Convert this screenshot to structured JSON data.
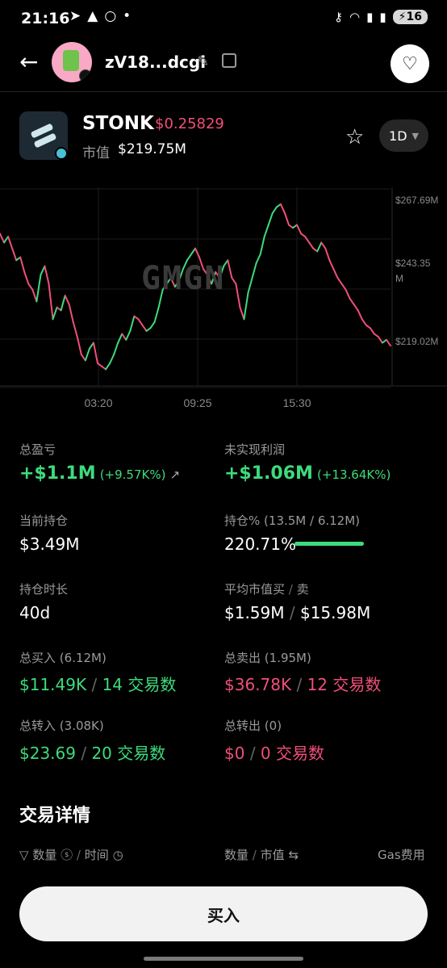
{
  "status_bar": {
    "time": "21:16",
    "battery": "16"
  },
  "header": {
    "wallet_name": "zV18...dcgi"
  },
  "token": {
    "symbol": "STONK",
    "price": "$0.25829",
    "mcap_label": "市值",
    "mcap_value": "$219.75M",
    "interval": "1D"
  },
  "chart_data": {
    "type": "line",
    "watermark": "GMGN",
    "y_ticks": [
      "$267.69M",
      "$243.35",
      "M",
      "$219.02M"
    ],
    "x_ticks": [
      "03:20",
      "09:25",
      "15:30"
    ],
    "ylim": [
      205,
      268
    ],
    "unit": "M",
    "colors": {
      "up": "#3ddb7b",
      "down": "#f04f78"
    },
    "series": [
      {
        "values": [
          255,
          252,
          254,
          250,
          246,
          247,
          242,
          238,
          236,
          232,
          241,
          244,
          238,
          226,
          230,
          229,
          234,
          231,
          225,
          220,
          214,
          212,
          216,
          218,
          211,
          210,
          209,
          211,
          214,
          218,
          221,
          219,
          222,
          227,
          226,
          224,
          222,
          223,
          225,
          230,
          236,
          238,
          240,
          237,
          239,
          243,
          246,
          248,
          250,
          247,
          243,
          241,
          238,
          242,
          240,
          244,
          246,
          240,
          238,
          230,
          226,
          235,
          240,
          245,
          248,
          254,
          258,
          262,
          264,
          265,
          262,
          258,
          257,
          258,
          255,
          254,
          252,
          250,
          249,
          252,
          250,
          246,
          243,
          240,
          238,
          236,
          233,
          231,
          229,
          226,
          224,
          223,
          221,
          220,
          218,
          219,
          217
        ]
      }
    ]
  },
  "stats": {
    "total_pnl": {
      "label": "总盈亏",
      "value": "+$1.1M",
      "sub": "(+9.57K%)"
    },
    "unrealized": {
      "label": "未实现利润",
      "value": "+$1.06M",
      "sub": "(+13.64K%)"
    },
    "holding": {
      "label": "当前持仓",
      "value": "$3.49M"
    },
    "holding_pct": {
      "label": "持仓%",
      "sub": "(13.5M / 6.12M)",
      "value": "220.71%",
      "fill_percent": 100
    },
    "hold_duration": {
      "label": "持仓时长",
      "value": "40d"
    },
    "avg_mcap": {
      "label": "平均市值买",
      "sep": "/",
      "label2": "卖",
      "buy": "$1.59M",
      "sell": "$15.98M"
    },
    "total_buy": {
      "label": "总买入",
      "sub": "(6.12M)",
      "amount": "$11.49K",
      "count": "14 交易数"
    },
    "total_sell": {
      "label": "总卖出",
      "sub": "(1.95M)",
      "amount": "$36.78K",
      "count": "12 交易数"
    },
    "transfer_in": {
      "label": "总转入",
      "sub": "(3.08K)",
      "amount": "$23.69",
      "count": "20 交易数"
    },
    "transfer_out": {
      "label": "总转出",
      "sub": "(0)",
      "amount": "$0",
      "count": "0 交易数"
    }
  },
  "trade_details": {
    "title": "交易详情",
    "col_amount": "数量",
    "col_time": "时间",
    "col_qty": "数量",
    "col_mcap": "市值",
    "col_gas": "Gas费用"
  },
  "buy_button": "买入"
}
